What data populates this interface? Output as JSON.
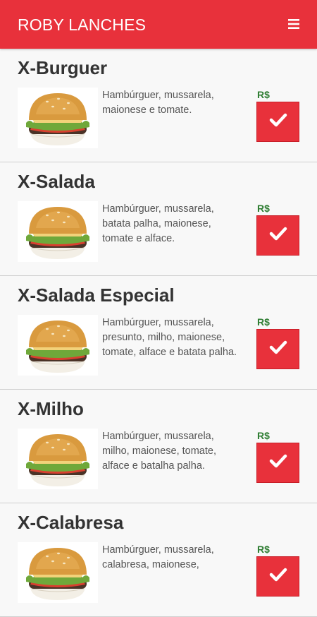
{
  "header": {
    "title": "ROBY LANCHES",
    "menu_icon": "hamburger-menu-icon",
    "color": "#e8313b"
  },
  "items": [
    {
      "name": "X-Burguer",
      "description": "Hambúrguer, mussarela, maionese e tomate.",
      "price": "R$",
      "image_icon": "burger-image"
    },
    {
      "name": "X-Salada",
      "description": "Hambúrguer, mussarela, batata palha, maionese, tomate e alface.",
      "price": "R$",
      "image_icon": "burger-image"
    },
    {
      "name": "X-Salada Especial",
      "description": "Hambúrguer, mussarela, presunto, milho, maionese, tomate, alface e batata palha.",
      "price": "R$",
      "image_icon": "burger-image"
    },
    {
      "name": "X-Milho",
      "description": "Hambúrguer, mussarela, milho, maionese, tomate, alface e batalha palha.",
      "price": "R$",
      "image_icon": "burger-image"
    },
    {
      "name": "X-Calabresa",
      "description": "Hambúrguer, mussarela, calabresa, maionese,",
      "price": "R$",
      "image_icon": "burger-image"
    }
  ],
  "button_icon": "check-icon",
  "price_color": "#2e7d32"
}
